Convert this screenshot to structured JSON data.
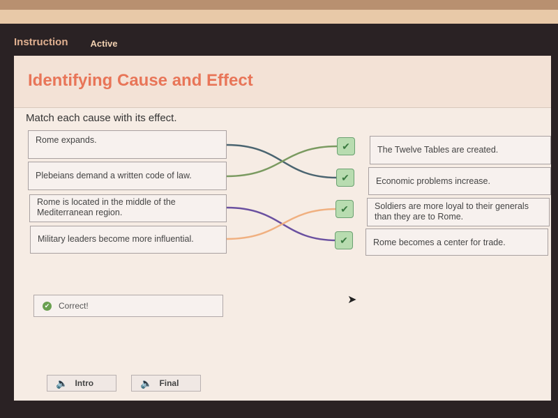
{
  "nav": {
    "instruction": "Instruction",
    "active": "Active"
  },
  "title": "Identifying Cause and Effect",
  "prompt": "Match each cause with its effect.",
  "causes": [
    "Rome expands.",
    "Plebeians demand a written code of law.",
    "Rome is located in the middle of the Mediterranean region.",
    "Military leaders become more influential."
  ],
  "effects": [
    "The Twelve Tables are created.",
    "Economic problems increase.",
    "Soldiers are more loyal to their generals than they are to Rome.",
    "Rome becomes a center for trade."
  ],
  "matches": [
    {
      "cause": 0,
      "effect": 1,
      "color": "#4a6470"
    },
    {
      "cause": 1,
      "effect": 0,
      "color": "#7a9a60"
    },
    {
      "cause": 2,
      "effect": 3,
      "color": "#6a50a0"
    },
    {
      "cause": 3,
      "effect": 2,
      "color": "#f0b080"
    }
  ],
  "feedback": "Correct!",
  "buttons": {
    "intro": "Intro",
    "final": "Final"
  }
}
